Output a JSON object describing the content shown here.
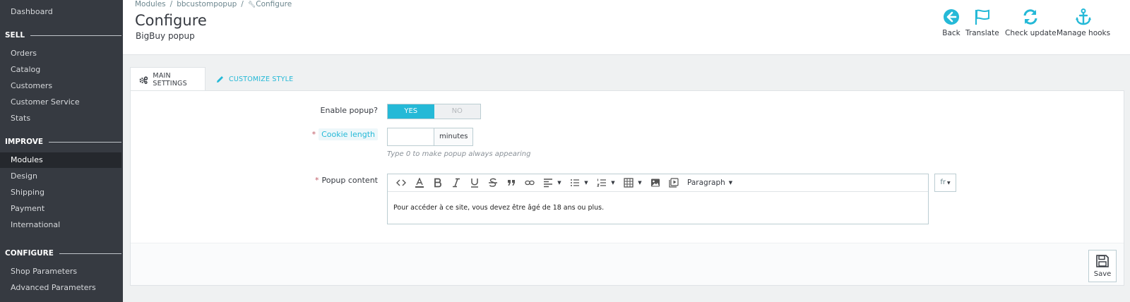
{
  "sidebar": {
    "dashboard": "Dashboard",
    "sections": [
      {
        "title": "SELL",
        "items": [
          "Orders",
          "Catalog",
          "Customers",
          "Customer Service",
          "Stats"
        ]
      },
      {
        "title": "IMPROVE",
        "items": [
          "Modules",
          "Design",
          "Shipping",
          "Payment",
          "International"
        ]
      },
      {
        "title": "CONFIGURE",
        "items": [
          "Shop Parameters",
          "Advanced Parameters"
        ]
      }
    ],
    "active_item": "Modules"
  },
  "header": {
    "breadcrumb": [
      "Modules",
      "bbcustompopup",
      "Configure"
    ],
    "title": "Configure",
    "subtitle": "BigBuy popup",
    "toolbar": [
      {
        "label": "Back",
        "icon": "back-icon"
      },
      {
        "label": "Translate",
        "icon": "flag-icon"
      },
      {
        "label": "Check update",
        "icon": "refresh-icon"
      },
      {
        "label": "Manage hooks",
        "icon": "anchor-icon"
      }
    ]
  },
  "tabs": [
    {
      "label": "MAIN SETTINGS",
      "icon": "cogs-icon",
      "active": true
    },
    {
      "label": "CUSTOMIZE STYLE",
      "icon": "pencil-icon",
      "active": false
    }
  ],
  "form": {
    "enable_popup": {
      "label": "Enable popup?",
      "yes": "YES",
      "no": "NO",
      "value": "YES"
    },
    "cookie_length": {
      "label": "Cookie length",
      "value": "",
      "addon": "minutes",
      "help": "Type 0 to make popup always appearing"
    },
    "popup_content": {
      "label": "Popup content",
      "format": "Paragraph",
      "text": "Pour accéder à ce site, vous devez être âgé de 18 ans ou plus.",
      "language": "fr"
    }
  },
  "footer": {
    "save_label": "Save"
  },
  "colors": {
    "accent": "#25b9d7",
    "sidebar": "#363a41",
    "required": "#c05c67"
  }
}
